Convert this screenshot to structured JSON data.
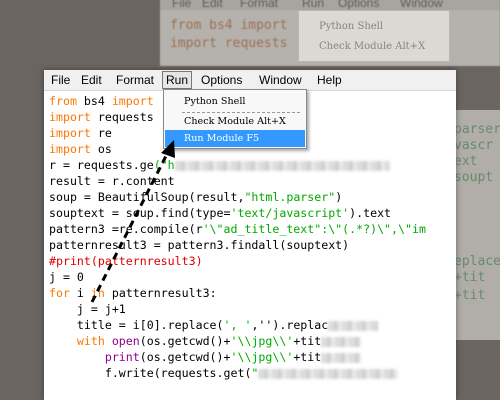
{
  "background": {
    "menu": [
      "File",
      "Edit",
      "Format",
      "Run",
      "Options",
      "Window"
    ],
    "code": [
      "from bs4 import",
      "import requests"
    ],
    "dropdown": [
      "Python Shell",
      "Check Module Alt+X"
    ],
    "right_side": [
      "parser",
      "vascr",
      "ext",
      "soupt",
      "eplace",
      "+tit",
      "+tit"
    ]
  },
  "menubar": {
    "items": [
      "File",
      "Edit",
      "Format",
      "Run",
      "Options",
      "Window",
      "Help"
    ],
    "active": "Run"
  },
  "run_menu": {
    "python_shell": "Python Shell",
    "check_module": "Check Module Alt+X",
    "run_module": "Run Module   F5"
  },
  "code": {
    "l1_kw1": "from",
    "l1_mod": " bs4 ",
    "l1_kw2": "import",
    "l2_kw": "import",
    "l2_mod": " requests",
    "l3_kw": "import",
    "l3_mod": " re",
    "l4_kw": "import",
    "l4_mod": " os",
    "l5_a": "r = requests.ge",
    "l5_str": "(\"h",
    "l6": "result = r.content",
    "l7_a": "soup = BeautifulSoup(result,",
    "l7_str": "\"html.parser\"",
    "l7_b": ")",
    "l8_a": "souptext = soup.find(type=",
    "l8_str": "'text/javascript'",
    "l8_b": ").text",
    "l9_a": "pattern3 =re.compile(r",
    "l9_str": "'\\\"ad_title_text\":\\\"(.*?)\\\",\\\"im",
    "l10": "patternresult3 = pattern3.findall(souptext)",
    "l11_cmt": "#print(patternresult3)",
    "l12": "j = 0",
    "l13_kw1": "for",
    "l13_a": " i ",
    "l13_kw2": "in",
    "l13_b": " patternresult3:",
    "l14": "    j = j+1",
    "l15_a": "    title = i[0].replace(",
    "l15_str": "', '",
    "l15_b": ",'').replac",
    "l16_kw": "    with",
    "l16_a": " ",
    "l16_bi": "open",
    "l16_b": "(os.getcwd()+",
    "l16_str": "'\\\\jpg\\\\'",
    "l16_c": "+tit",
    "l17_a": "        ",
    "l17_bi": "print",
    "l17_b": "(os.getcwd()+",
    "l17_str": "'\\\\jpg\\\\'",
    "l17_c": "+tit",
    "l18_a": "        f.write(requests.get(",
    "l18_str": "\""
  },
  "colors": {
    "keyword": "#ff7700",
    "string": "#00aa00",
    "comment": "#dd0000",
    "builtin": "#900090",
    "menu_highlight": "#3399ff"
  },
  "icons": [
    "dashed-arrow-icon"
  ]
}
